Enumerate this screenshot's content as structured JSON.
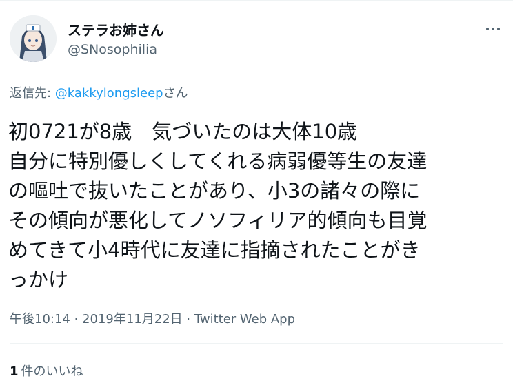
{
  "author": {
    "display_name": "ステラお姉さん",
    "handle": "@SNosophilia"
  },
  "reply": {
    "prefix": "返信先: ",
    "mention": "@kakkylongsleep",
    "suffix": "さん"
  },
  "tweet": {
    "lines": [
      "初0721が8歳　気づいたのは大体10歳",
      "自分に特別優しくしてくれる病弱優等生の友達",
      "の嘔吐で抜いたことがあり、小3の諸々の際に",
      "その傾向が悪化してノソフィリア的傾向も目覚",
      "めてきて小4時代に友達に指摘されたことがき",
      "っかけ"
    ]
  },
  "meta": {
    "time": "午後10:14",
    "separator1": " · ",
    "date": "2019年11月22日",
    "separator2": " · ",
    "source": "Twitter Web App"
  },
  "likes": {
    "count": "1",
    "label": "件のいいね"
  },
  "icons": {
    "more": "more-horizontal-icon"
  },
  "colors": {
    "text": "#0f1419",
    "secondary": "#536471",
    "link": "#1d9bf0",
    "divider": "#eff3f4"
  }
}
